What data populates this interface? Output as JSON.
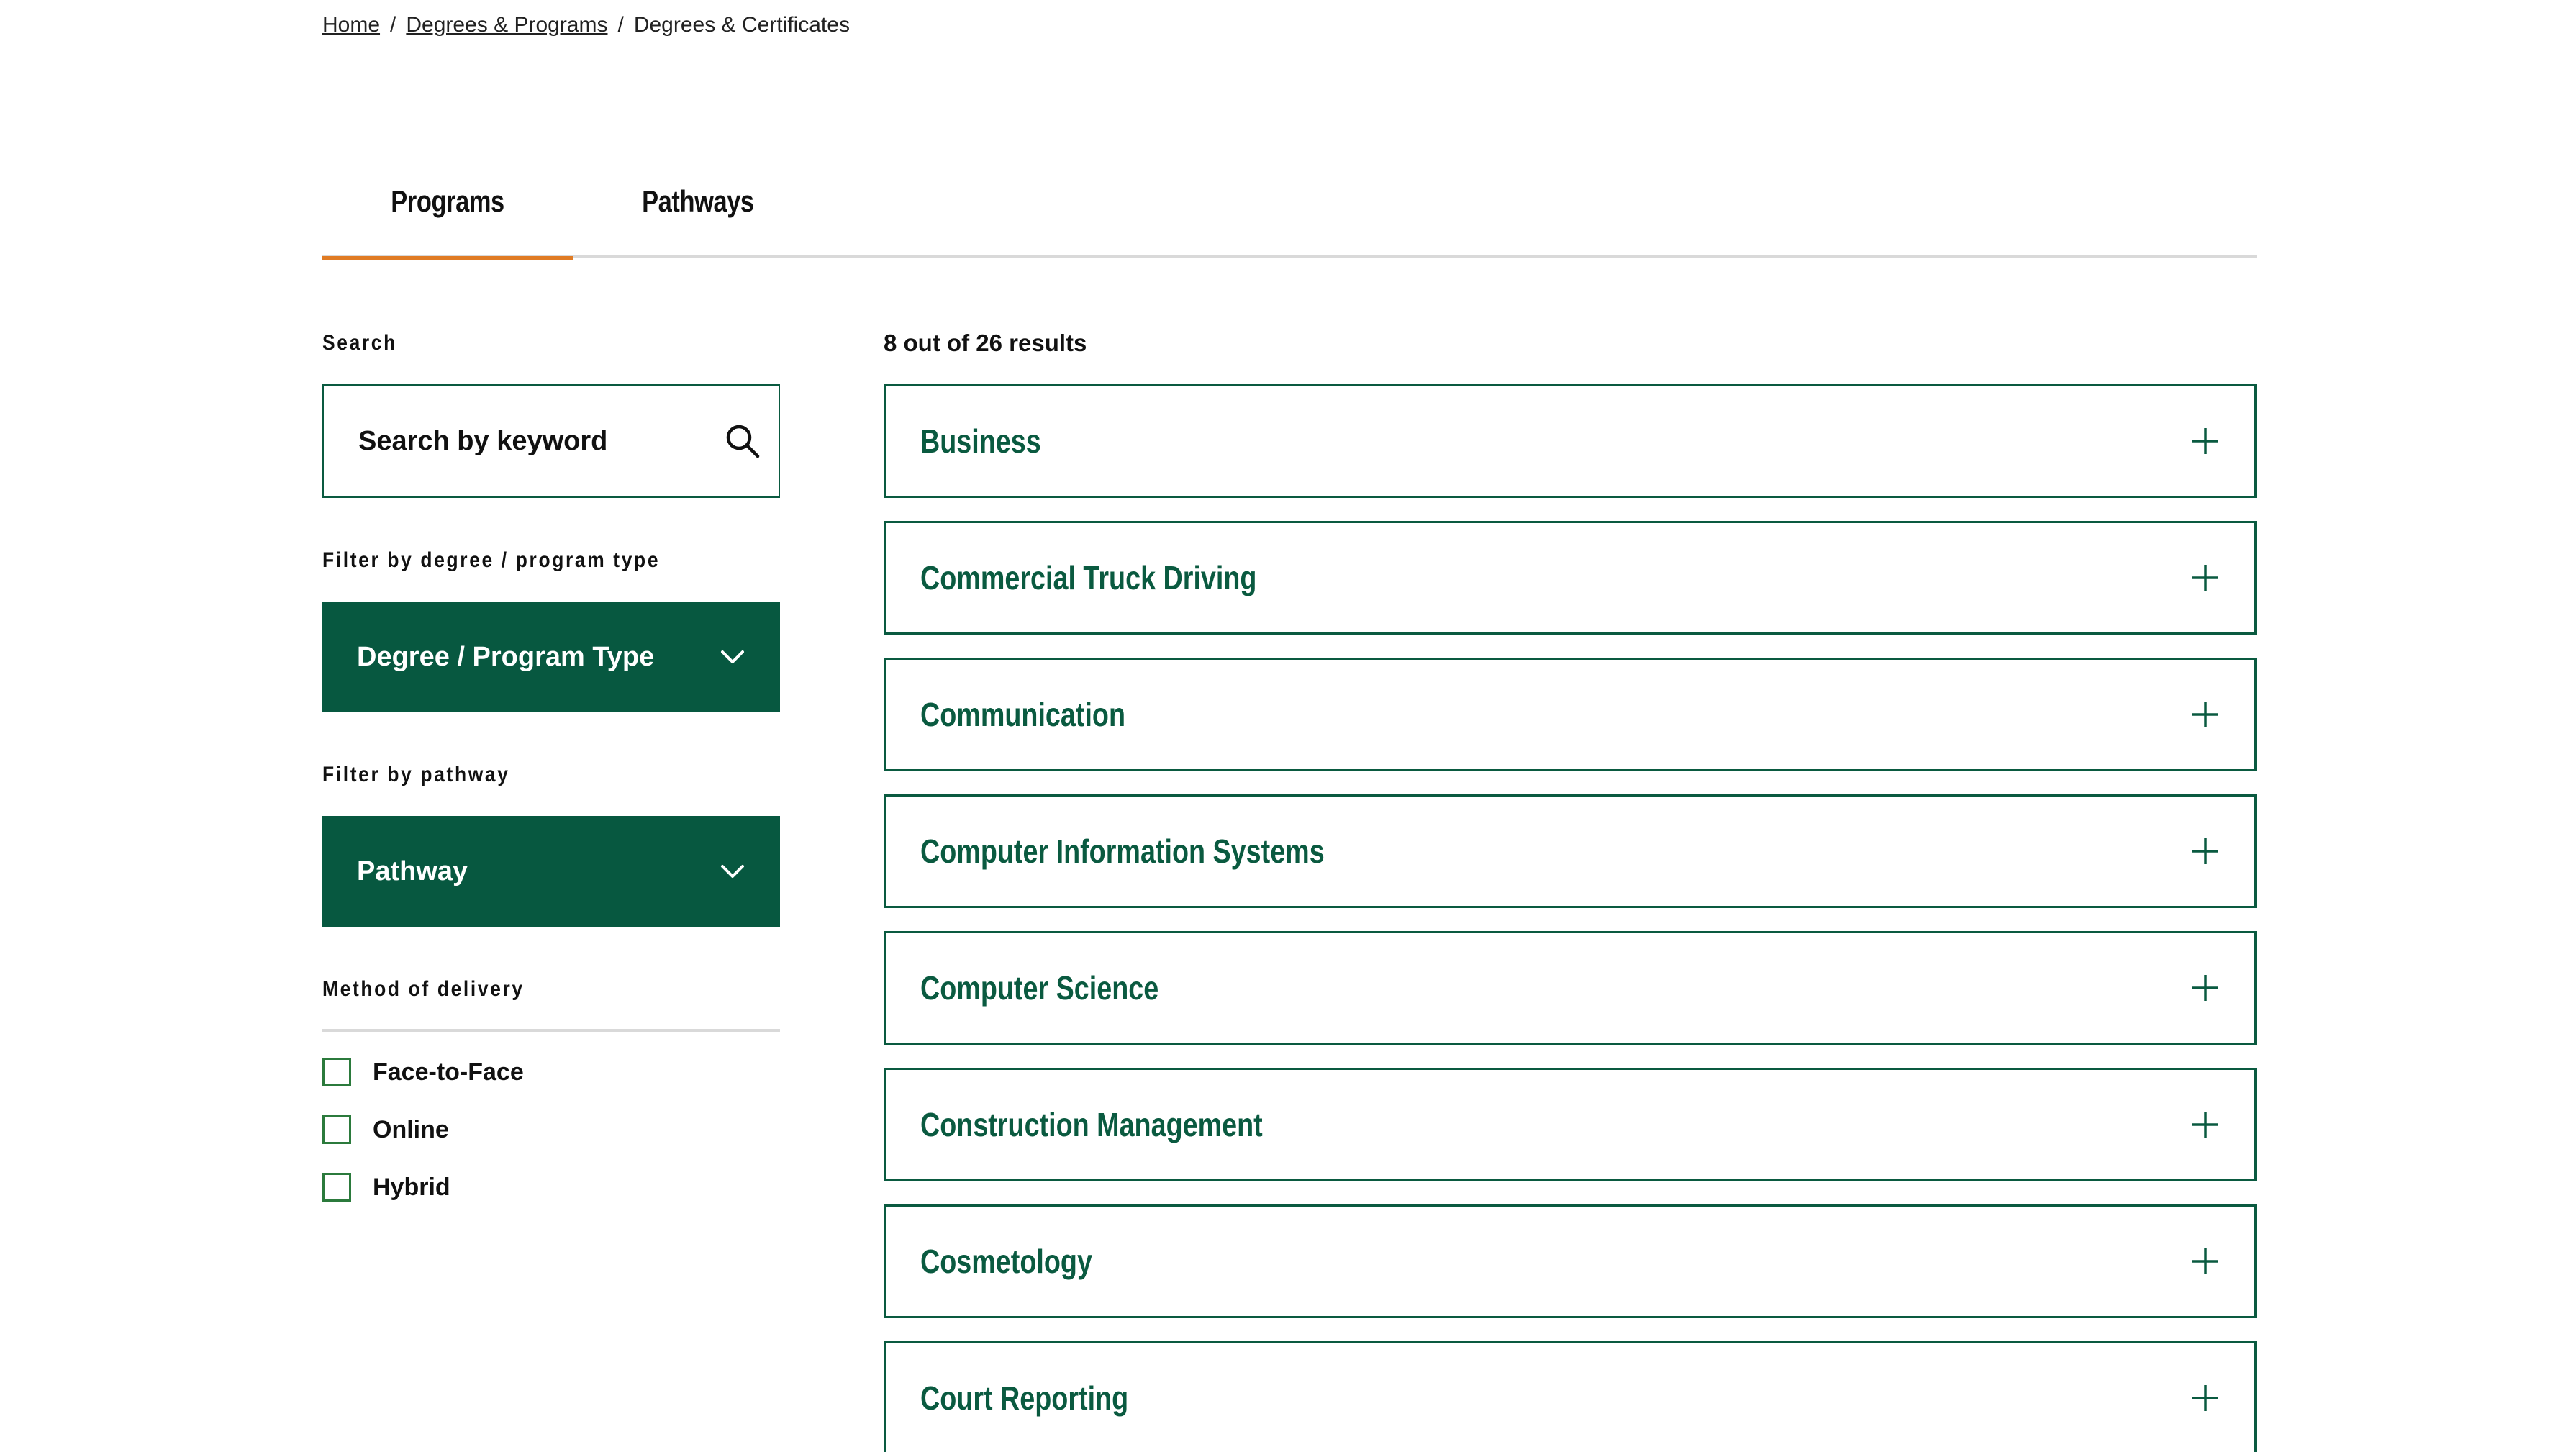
{
  "breadcrumb": {
    "home": "Home",
    "degrees_programs": "Degrees & Programs",
    "current": "Degrees & Certificates",
    "separator": "/"
  },
  "tabs": [
    {
      "label": "Programs",
      "active": true
    },
    {
      "label": "Pathways",
      "active": false
    }
  ],
  "sidebar": {
    "search_label": "Search",
    "search_placeholder": "Search by keyword",
    "degree_filter_label": "Filter by degree / program type",
    "degree_dropdown_value": "Degree / Program Type",
    "pathway_filter_label": "Filter by pathway",
    "pathway_dropdown_value": "Pathway",
    "delivery_label": "Method of delivery",
    "delivery_options": [
      {
        "label": "Face-to-Face",
        "checked": false
      },
      {
        "label": "Online",
        "checked": false
      },
      {
        "label": "Hybrid",
        "checked": false
      }
    ]
  },
  "results": {
    "count_text": "8 out of 26 results",
    "items": [
      {
        "title": "Business"
      },
      {
        "title": "Commercial Truck Driving"
      },
      {
        "title": "Communication"
      },
      {
        "title": "Computer Information Systems"
      },
      {
        "title": "Computer Science"
      },
      {
        "title": "Construction Management"
      },
      {
        "title": "Cosmetology"
      },
      {
        "title": "Court Reporting"
      }
    ]
  },
  "colors": {
    "brand_green": "#075840",
    "accent_orange": "#e07b24",
    "checkbox_green": "#2b7a3c",
    "divider_gray": "#d9d9d9"
  },
  "icons": {
    "search": "search-icon",
    "dropdown": "chevron-down-icon",
    "accordion": "plus-icon"
  }
}
